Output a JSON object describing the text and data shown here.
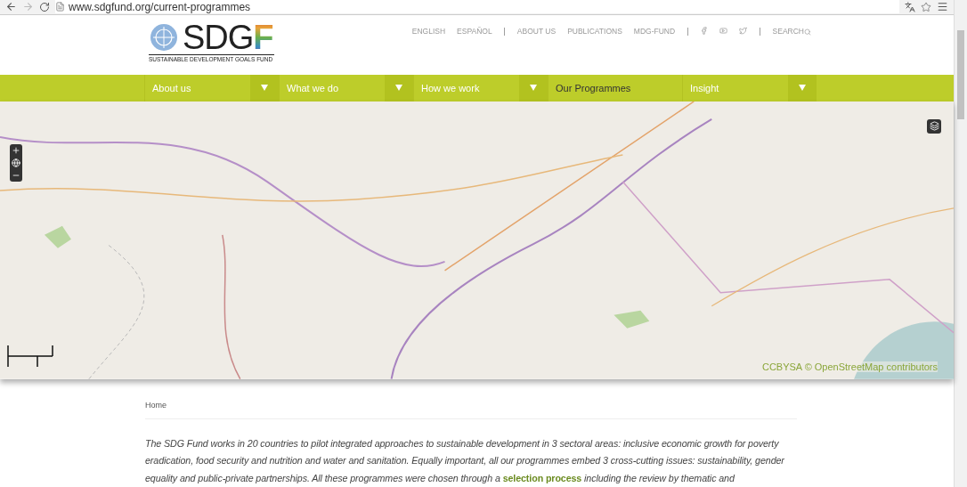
{
  "browser": {
    "url": "www.sdgfund.org/current-programmes"
  },
  "header": {
    "logo": {
      "text": "SDG",
      "accent": "F",
      "tagline": "SUSTAINABLE DEVELOPMENT GOALS FUND"
    },
    "links": [
      {
        "kind": "link",
        "label": "ENGLISH"
      },
      {
        "kind": "link",
        "label": "ESPAÑOL"
      },
      {
        "kind": "separator",
        "label": "|"
      },
      {
        "kind": "link",
        "label": "ABOUT US"
      },
      {
        "kind": "link",
        "label": "PUBLICATIONS"
      },
      {
        "kind": "link",
        "label": "MDG-FUND"
      },
      {
        "kind": "separator",
        "label": "|"
      },
      {
        "kind": "social"
      },
      {
        "kind": "separator",
        "label": "|"
      },
      {
        "kind": "search",
        "label": "SEARCH"
      }
    ]
  },
  "nav": [
    {
      "label": "About us",
      "dropdown": true,
      "selected": false
    },
    {
      "label": "What we do",
      "dropdown": true,
      "selected": false
    },
    {
      "label": "How we work",
      "dropdown": true,
      "selected": false
    },
    {
      "label": "Our Programmes",
      "dropdown": false,
      "selected": true
    },
    {
      "label": "Insight",
      "dropdown": true,
      "selected": false
    }
  ],
  "map": {
    "kind": "picture",
    "attribution": "CCBYSA © OpenStreetMap contributors"
  },
  "breadcrumb": "Home",
  "intro": {
    "before": "The SDG Fund works in 20 countries to pilot integrated approaches to sustainable development in 3 sectoral areas: inclusive economic growth for poverty eradication, food security and nutrition and water and sanitation. Equally important, all our programmes embed 3 cross-cutting issues: sustainability, gender equality and public-private partnerships. All these programmes were chosen through a",
    "link": "selection process",
    "after": "including the review by thematic and"
  }
}
